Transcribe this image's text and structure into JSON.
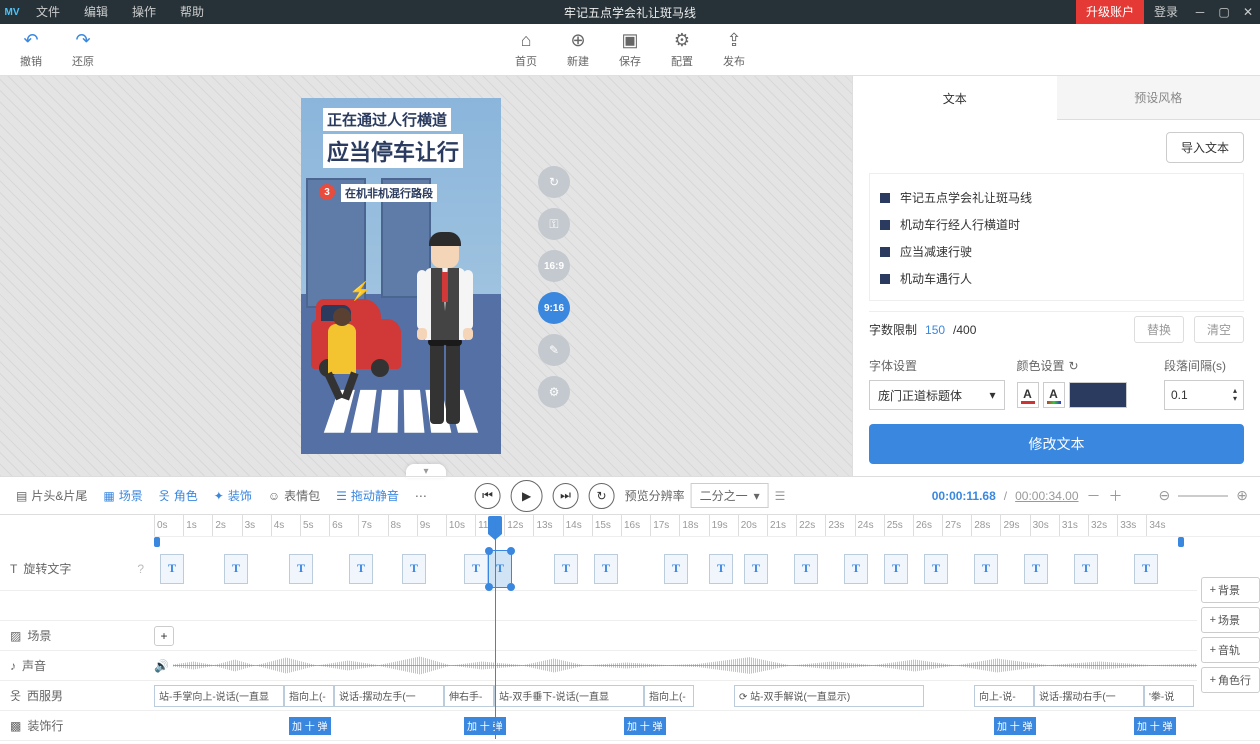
{
  "titlebar": {
    "menu": [
      "文件",
      "编辑",
      "操作",
      "帮助"
    ],
    "title": "牢记五点学会礼让斑马线",
    "upgrade": "升级账户",
    "login": "登录"
  },
  "toolbar": {
    "undo": "撤销",
    "redo": "还原",
    "home": "首页",
    "new": "新建",
    "save": "保存",
    "config": "配置",
    "publish": "发布"
  },
  "canvas": {
    "text1": "正在通过人行横道",
    "text2": "应当停车让行",
    "badge": "3",
    "text3": "在机非机混行路段",
    "ratio1": "16:9",
    "ratio2": "9:16"
  },
  "panel": {
    "tabs": [
      "文本",
      "预设风格"
    ],
    "import": "导入文本",
    "items": [
      "牢记五点学会礼让斑马线",
      "机动车行经人行横道时",
      "应当减速行驶",
      "机动车遇行人"
    ],
    "limit_label": "字数限制",
    "limit_count": "150",
    "limit_total": " /400",
    "replace": "替换",
    "clear": "清空",
    "font_label": "字体设置",
    "color_label": "颜色设置",
    "gap_label": "段落间隔(s)",
    "font_value": "庞门正道标题体",
    "gap_value": "0.1",
    "apply": "修改文本"
  },
  "midbar": {
    "items": [
      "片头&片尾",
      "场景",
      "角色",
      "装饰",
      "表情包",
      "拖动静音"
    ],
    "ratio_label": "预览分辨率",
    "ratio_value": "二分之一",
    "time_cur": "00:00:11.68",
    "time_tot": "00:00:34.00",
    "sep": " / "
  },
  "timeline": {
    "ticks": [
      "0s",
      "1s",
      "2s",
      "3s",
      "4s",
      "5s",
      "6s",
      "7s",
      "8s",
      "9s",
      "10s",
      "11s",
      "12s",
      "13s",
      "14s",
      "15s",
      "16s",
      "17s",
      "18s",
      "19s",
      "20s",
      "21s",
      "22s",
      "23s",
      "24s",
      "25s",
      "26s",
      "27s",
      "28s",
      "29s",
      "30s",
      "31s",
      "32s",
      "33s",
      "34s"
    ],
    "tracks": {
      "text": "旋转文字",
      "scene": "场景",
      "audio": "声音",
      "character": "西服男",
      "deco": "装饰行"
    },
    "side_adds": [
      "背景",
      "场景",
      "音轨",
      "角色行"
    ],
    "actions": [
      "站-手掌向上-说话(一直显",
      "指向上(-",
      "说话-摆动左手(一",
      "伸右手-",
      "站-双手垂下-说话(一直显",
      "指向上(-",
      "⟳ 站-双手解说(一直显示)",
      "向上-说-",
      "说话-摆动右手(一",
      "'拳-说"
    ],
    "deco_label": "加 十 弹"
  }
}
